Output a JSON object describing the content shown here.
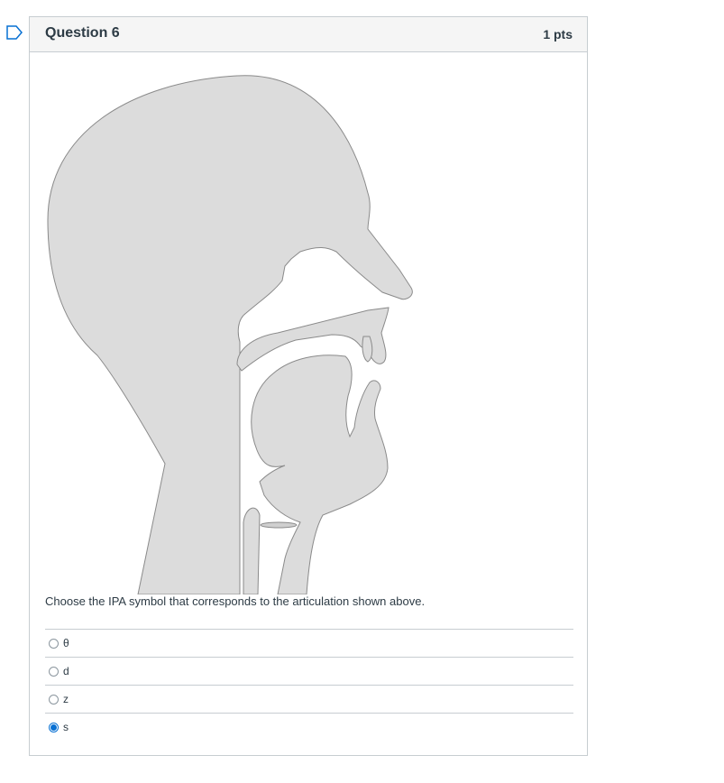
{
  "question": {
    "title": "Question 6",
    "points": "1 pts",
    "prompt": "Choose the IPA symbol that corresponds to the articulation shown above.",
    "figure_icon": "sagittal-vocal-tract-diagram",
    "flag_icon": "bookmark-flag-icon",
    "accent_color": "#0770d3"
  },
  "answers": [
    {
      "label": "θ",
      "selected": false
    },
    {
      "label": "d",
      "selected": false
    },
    {
      "label": "z",
      "selected": false
    },
    {
      "label": "s",
      "selected": true
    }
  ]
}
